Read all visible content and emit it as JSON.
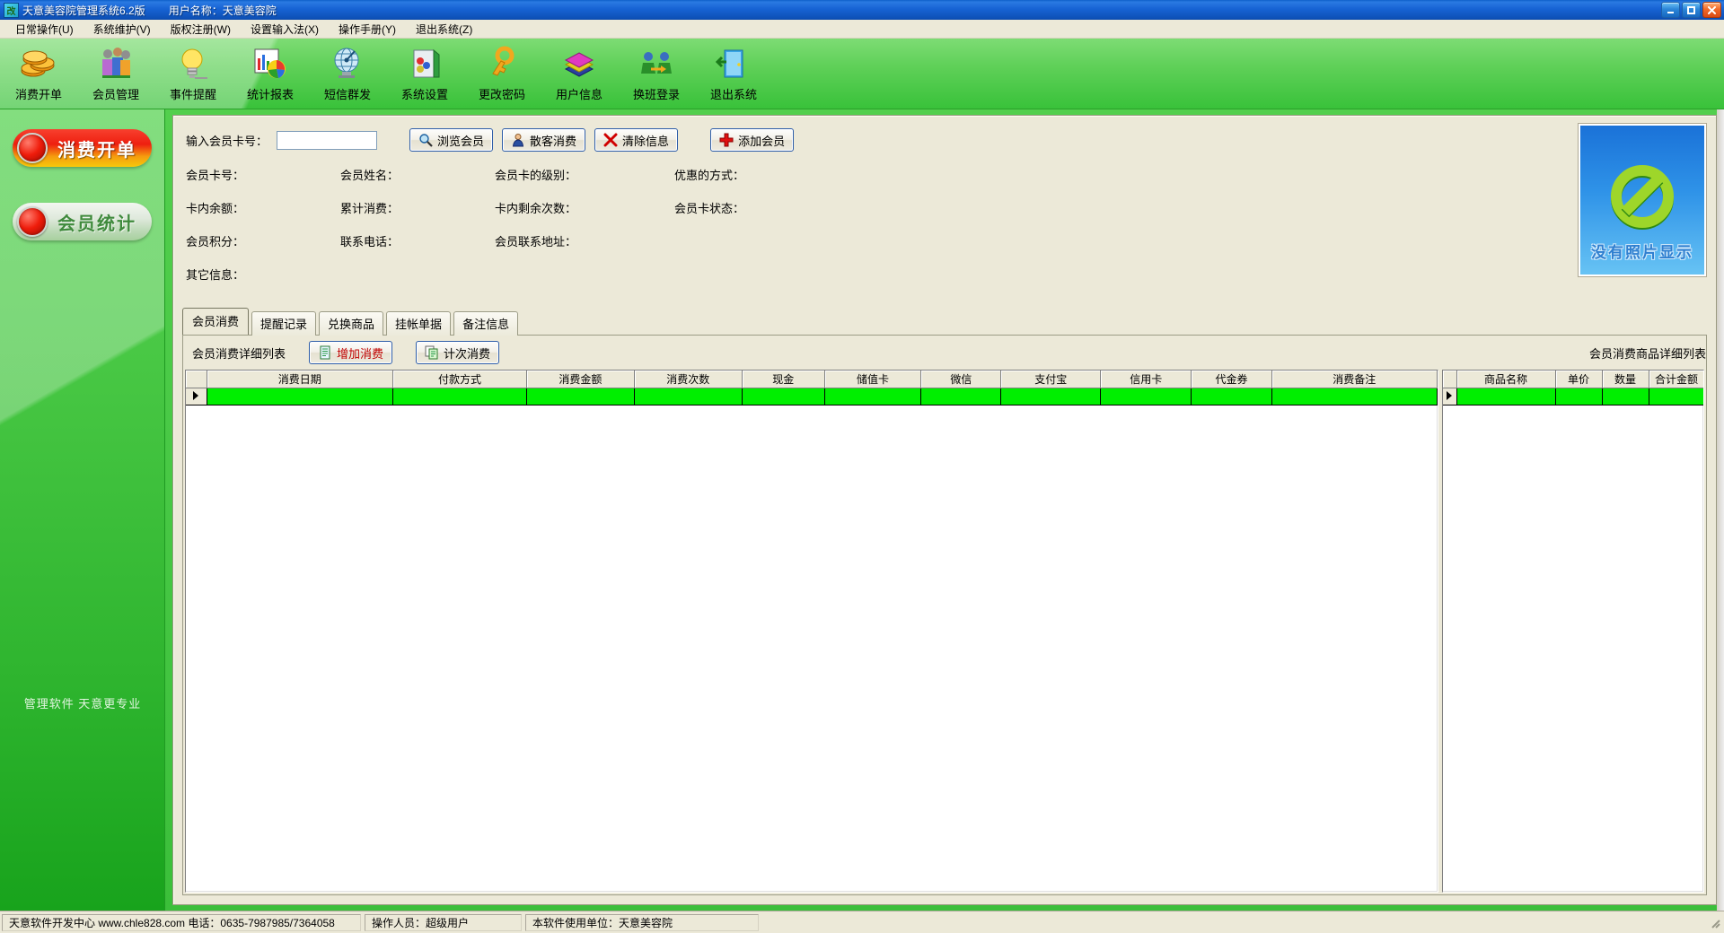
{
  "window": {
    "title": "天意美容院管理系统6.2版",
    "user_label": "用户名称：天意美容院",
    "icon": "app-icon",
    "controls": {
      "minimize": "minimize-icon",
      "maximize": "maximize-icon",
      "close": "close-icon"
    }
  },
  "menubar": {
    "items": [
      {
        "label": "日常操作(U)"
      },
      {
        "label": "系统维护(V)"
      },
      {
        "label": "版权注册(W)"
      },
      {
        "label": "设置输入法(X)"
      },
      {
        "label": "操作手册(Y)"
      },
      {
        "label": "退出系统(Z)"
      }
    ]
  },
  "toolbar": {
    "buttons": [
      {
        "label": "消费开单",
        "icon": "coins-icon"
      },
      {
        "label": "会员管理",
        "icon": "people-icon"
      },
      {
        "label": "事件提醒",
        "icon": "lightbulb-icon"
      },
      {
        "label": "统计报表",
        "icon": "chart-icon"
      },
      {
        "label": "短信群发",
        "icon": "globe-icon"
      },
      {
        "label": "系统设置",
        "icon": "settings-icon"
      },
      {
        "label": "更改密码",
        "icon": "key-icon"
      },
      {
        "label": "用户信息",
        "icon": "books-icon"
      },
      {
        "label": "换班登录",
        "icon": "swap-icon"
      },
      {
        "label": "退出系统",
        "icon": "exit-door-icon"
      }
    ]
  },
  "sidebar": {
    "buttons": [
      {
        "label": "消费开单",
        "style": "red"
      },
      {
        "label": "会员统计",
        "style": "white"
      }
    ],
    "watermark": "管理软件  天意更专业"
  },
  "search": {
    "label": "输入会员卡号：",
    "input_value": "",
    "input_placeholder": "",
    "buttons": [
      {
        "label": "浏览会员",
        "icon": "magnifier-icon"
      },
      {
        "label": "散客消费",
        "icon": "person-icon"
      },
      {
        "label": "清除信息",
        "icon": "x-red-icon"
      },
      {
        "label": "添加会员",
        "icon": "plus-red-icon"
      }
    ]
  },
  "member_info": {
    "rows": [
      [
        "会员卡号：",
        "会员姓名：",
        "会员卡的级别：",
        "优惠的方式："
      ],
      [
        "卡内余额：",
        "累计消费：",
        "卡内剩余次数：",
        "会员卡状态："
      ],
      [
        "会员积分：",
        "联系电话：",
        "会员联系地址：",
        ""
      ],
      [
        "其它信息：",
        "",
        "",
        ""
      ]
    ]
  },
  "photo": {
    "no_photo_text": "没有照片显示",
    "icon": "no-entry-icon"
  },
  "tabs": [
    {
      "label": "会员消费",
      "active": true
    },
    {
      "label": "提醒记录",
      "active": false
    },
    {
      "label": "兑换商品",
      "active": false
    },
    {
      "label": "挂帐单据",
      "active": false
    },
    {
      "label": "备注信息",
      "active": false
    }
  ],
  "consumption_panel": {
    "title": "会员消费详细列表",
    "buttons": [
      {
        "label": "增加消费",
        "icon": "document-icon",
        "color": "#c00000"
      },
      {
        "label": "计次消费",
        "icon": "copy-icon",
        "color": "#000000"
      }
    ],
    "grid": {
      "columns": [
        "消费日期",
        "付款方式",
        "消费金额",
        "消费次数",
        "现金",
        "储值卡",
        "微信",
        "支付宝",
        "信用卡",
        "代金券",
        "消费备注"
      ],
      "rows": [
        [
          "",
          "",
          "",
          "",
          "",
          "",
          "",
          "",
          "",
          "",
          ""
        ]
      ]
    }
  },
  "goods_panel": {
    "title": "会员消费商品详细列表",
    "grid": {
      "columns": [
        "商品名称",
        "单价",
        "数量",
        "合计金额"
      ],
      "rows": [
        [
          "",
          "",
          "",
          ""
        ]
      ]
    }
  },
  "statusbar": {
    "cells": [
      "天意软件开发中心 www.chle828.com 电话：0635-7987985/7364058",
      "操作人员：超级用户",
      "本软件使用单位：天意美容院"
    ]
  },
  "colors": {
    "toolbar_green": "#4ec94a",
    "grid_row_green": "#00ef00",
    "panel_beige": "#ece9d8",
    "title_blue": "#1763d4",
    "accent_red": "#c00000"
  }
}
